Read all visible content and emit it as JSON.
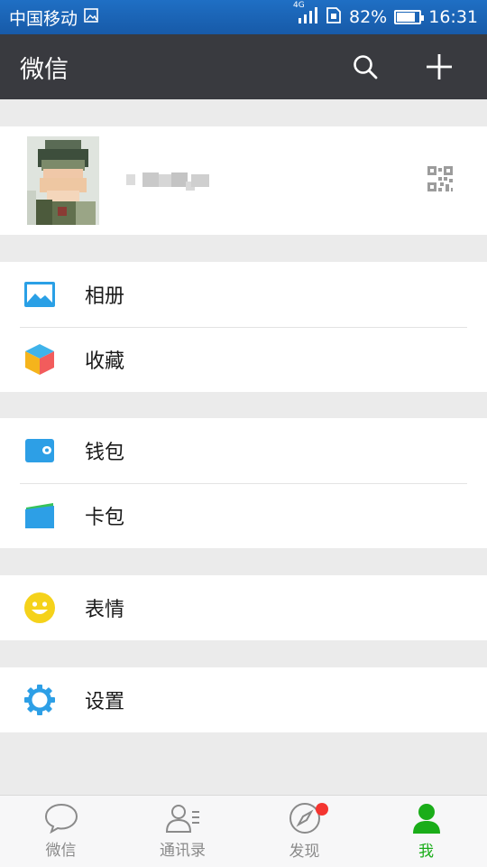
{
  "status_bar": {
    "carrier": "中国移动",
    "network": "4G",
    "battery": "82%",
    "battery_level": 0.82,
    "time": "16:31"
  },
  "app_bar": {
    "title": "微信",
    "search_icon": "search-icon",
    "add_icon": "plus-icon"
  },
  "profile": {
    "avatar_icon": "avatar",
    "qr_icon": "qr-code-icon"
  },
  "menu_groups": [
    {
      "items": [
        {
          "label": "相册",
          "icon": "album-icon",
          "color": "#2aa0e6"
        },
        {
          "label": "收藏",
          "icon": "favorites-cube-icon",
          "color": "#f5b41c"
        }
      ]
    },
    {
      "items": [
        {
          "label": "钱包",
          "icon": "wallet-icon",
          "color": "#2d9fe6"
        },
        {
          "label": "卡包",
          "icon": "card-package-icon",
          "color": "#2d9fe6"
        }
      ]
    },
    {
      "items": [
        {
          "label": "表情",
          "icon": "smiley-icon",
          "color": "#f5d21a"
        }
      ]
    },
    {
      "items": [
        {
          "label": "设置",
          "icon": "settings-gear-icon",
          "color": "#2d9fe6"
        }
      ]
    }
  ],
  "tabs": [
    {
      "label": "微信",
      "icon": "chat-bubble-icon",
      "active": false
    },
    {
      "label": "通讯录",
      "icon": "contacts-icon",
      "active": false
    },
    {
      "label": "发现",
      "icon": "compass-icon",
      "active": false,
      "badge": true
    },
    {
      "label": "我",
      "icon": "me-person-icon",
      "active": true
    }
  ],
  "colors": {
    "status_bar": "#1f6fc4",
    "app_bar": "#393a3f",
    "background": "#ebebeb",
    "active_tab": "#1aad19",
    "badge": "#f43530"
  }
}
